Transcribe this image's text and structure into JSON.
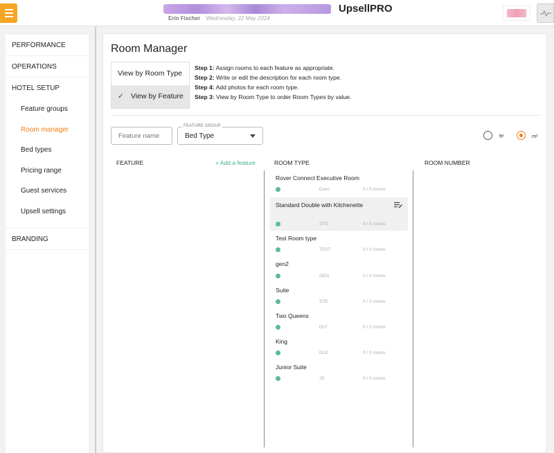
{
  "header": {
    "app_title": "UpsellPRO",
    "user_name": "Erin Fischer",
    "date": "Wednesday, 22 May 2024",
    "accent": "#f5a623"
  },
  "sidebar": {
    "sections": [
      {
        "label": "PERFORMANCE"
      },
      {
        "label": "OPERATIONS"
      },
      {
        "label": "HOTEL SETUP"
      },
      {
        "label": "BRANDING"
      }
    ],
    "setup_items": [
      {
        "label": "Feature groups",
        "active": false
      },
      {
        "label": "Room manager",
        "active": true
      },
      {
        "label": "Bed types",
        "active": false
      },
      {
        "label": "Pricing range",
        "active": false
      },
      {
        "label": "Guest services",
        "active": false
      },
      {
        "label": "Upsell settings",
        "active": false
      }
    ],
    "active_color": "#f07d14"
  },
  "main": {
    "title": "Room Manager",
    "view_toggle": {
      "by_room_type": "View by Room Type",
      "by_feature": "View by Feature",
      "selected": "by_feature"
    },
    "steps": [
      {
        "label": "Step 1:",
        "text": " Assign rooms to each feature as appropriate."
      },
      {
        "label": "Step 2:",
        "text": " Write or edit the description for each room type."
      },
      {
        "label": "Step 4:",
        "text": " Add photos for each room type."
      },
      {
        "label": "Step 3:",
        "text": " View by Room Type to order Room Types by value."
      }
    ],
    "filters": {
      "feature_name_placeholder": "Feature name",
      "feature_group_legend": "FEATURE GROUP",
      "feature_group_value": "Bed Type"
    },
    "units": {
      "ft": "ft²",
      "m": "m²",
      "selected": "m²"
    },
    "columns": {
      "feature": "FEATURE",
      "add_feature": "+ Add a feature",
      "room_type": "ROOM TYPE",
      "room_number": "ROOM NUMBER"
    },
    "room_types": [
      {
        "name": "Rover Connect Executive Room",
        "code": "Exec",
        "count": "0 / 0 rooms"
      },
      {
        "name": "Standard Double with Kitchenette",
        "code": "STD",
        "count": "0 / 0 rooms"
      },
      {
        "name": "Test Room type",
        "code": "TEST",
        "count": "0 / 0 rooms"
      },
      {
        "name": "gen2",
        "code": "GEN",
        "count": "0 / 0 rooms"
      },
      {
        "name": "Suite",
        "code": "STE",
        "count": "0 / 0 rooms"
      },
      {
        "name": "Two Queens",
        "code": "DLT",
        "count": "0 / 0 rooms"
      },
      {
        "name": "King",
        "code": "DLK",
        "count": "0 / 0 rooms"
      },
      {
        "name": "Junior Suite",
        "code": "JS",
        "count": "0 / 0 rooms"
      }
    ],
    "dot_color": "#5cb8a2",
    "link_color": "#3fae8e"
  }
}
